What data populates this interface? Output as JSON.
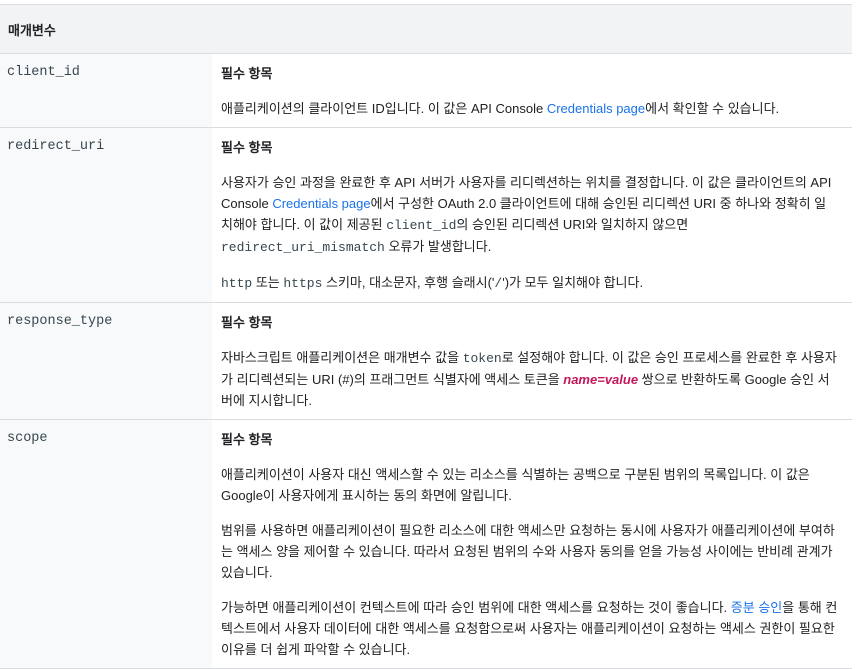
{
  "header": {
    "param_col": "매개변수"
  },
  "rows": {
    "client_id": {
      "name": "client_id",
      "required": "필수 항목",
      "p1_a": "애플리케이션의 클라이언트 ID입니다. 이 값은 API Console ",
      "p1_link": "Credentials page",
      "p1_b": "에서 확인할 수 있습니다."
    },
    "redirect_uri": {
      "name": "redirect_uri",
      "required": "필수 항목",
      "p1_a": "사용자가 승인 과정을 완료한 후 API 서버가 사용자를 리디렉션하는 위치를 결정합니다. 이 값은 클라이언트의 API Console ",
      "p1_link": "Credentials page",
      "p1_b": "에서 구성한 OAuth 2.0 클라이언트에 대해 승인된 리디렉션 URI 중 하나와 정확히 일치해야 합니다. 이 값이 제공된 ",
      "p1_code1": "client_id",
      "p1_c": "의 승인된 리디렉션 URI와 일치하지 않으면 ",
      "p1_code2": "redirect_uri_mismatch",
      "p1_d": " 오류가 발생합니다.",
      "p2_code1": "http",
      "p2_a": " 또는 ",
      "p2_code2": "https",
      "p2_b": " 스키마, 대소문자, 후행 슬래시('",
      "p2_code3": "/",
      "p2_c": "')가 모두 일치해야 합니다."
    },
    "response_type": {
      "name": "response_type",
      "required": "필수 항목",
      "p1_a": "자바스크립트 애플리케이션은 매개변수 값을 ",
      "p1_code": "token",
      "p1_b": "로 설정해야 합니다. 이 값은 승인 프로세스를 완료한 후 사용자가 리디렉션되는 URI (",
      "p1_hash": "#",
      "p1_c": ")의 프래그먼트 식별자에 액세스 토큰을 ",
      "p1_var": "name=value",
      "p1_d": " 쌍으로 반환하도록 Google 승인 서버에 지시합니다."
    },
    "scope": {
      "name": "scope",
      "required": "필수 항목",
      "p1": "애플리케이션이 사용자 대신 액세스할 수 있는 리소스를 식별하는 공백으로 구분된 범위의 목록입니다. 이 값은 Google이 사용자에게 표시하는 동의 화면에 알립니다.",
      "p2": "범위를 사용하면 애플리케이션이 필요한 리소스에 대한 액세스만 요청하는 동시에 사용자가 애플리케이션에 부여하는 액세스 양을 제어할 수 있습니다. 따라서 요청된 범위의 수와 사용자 동의를 얻을 가능성 사이에는 반비례 관계가 있습니다.",
      "p3_a": "가능하면 애플리케이션이 컨텍스트에 따라 승인 범위에 대한 액세스를 요청하는 것이 좋습니다. ",
      "p3_link": "증분 승인",
      "p3_b": "을 통해 컨텍스트에서 사용자 데이터에 대한 액세스를 요청함으로써 사용자는 애플리케이션이 요청하는 액세스 권한이 필요한 이유를 더 쉽게 파악할 수 있습니다."
    }
  }
}
